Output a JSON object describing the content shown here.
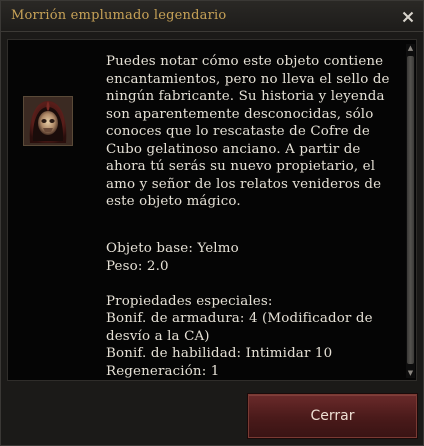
{
  "window": {
    "title": "Morrión emplumado legendario",
    "close_icon": "close-icon"
  },
  "item": {
    "icon": "helmet-icon",
    "description": "Puedes notar cómo este objeto contiene encantamientos, pero no lleva el sello de ningún fabricante. Su historia y leyenda son aparentemente desconocidas, sólo conoces que lo rescataste de Cofre de Cubo gelatinoso anciano. A partir de ahora tú serás su nuevo propietario, el amo y señor de los relatos venideros de este objeto mágico.",
    "base_object": "Objeto base: Yelmo",
    "weight": "Peso: 2.0",
    "special_properties_heading": "Propiedades especiales:",
    "properties": [
      "Bonif. de armadura: 4 (Modificador de desvío a la CA)",
      "Bonif. de habilidad: Intimidar 10",
      "Regeneración: 1"
    ]
  },
  "buttons": {
    "close_label": "Cerrar"
  },
  "colors": {
    "title": "#c7a257",
    "text": "#e6e1d6",
    "button": "#4a1a1a"
  }
}
